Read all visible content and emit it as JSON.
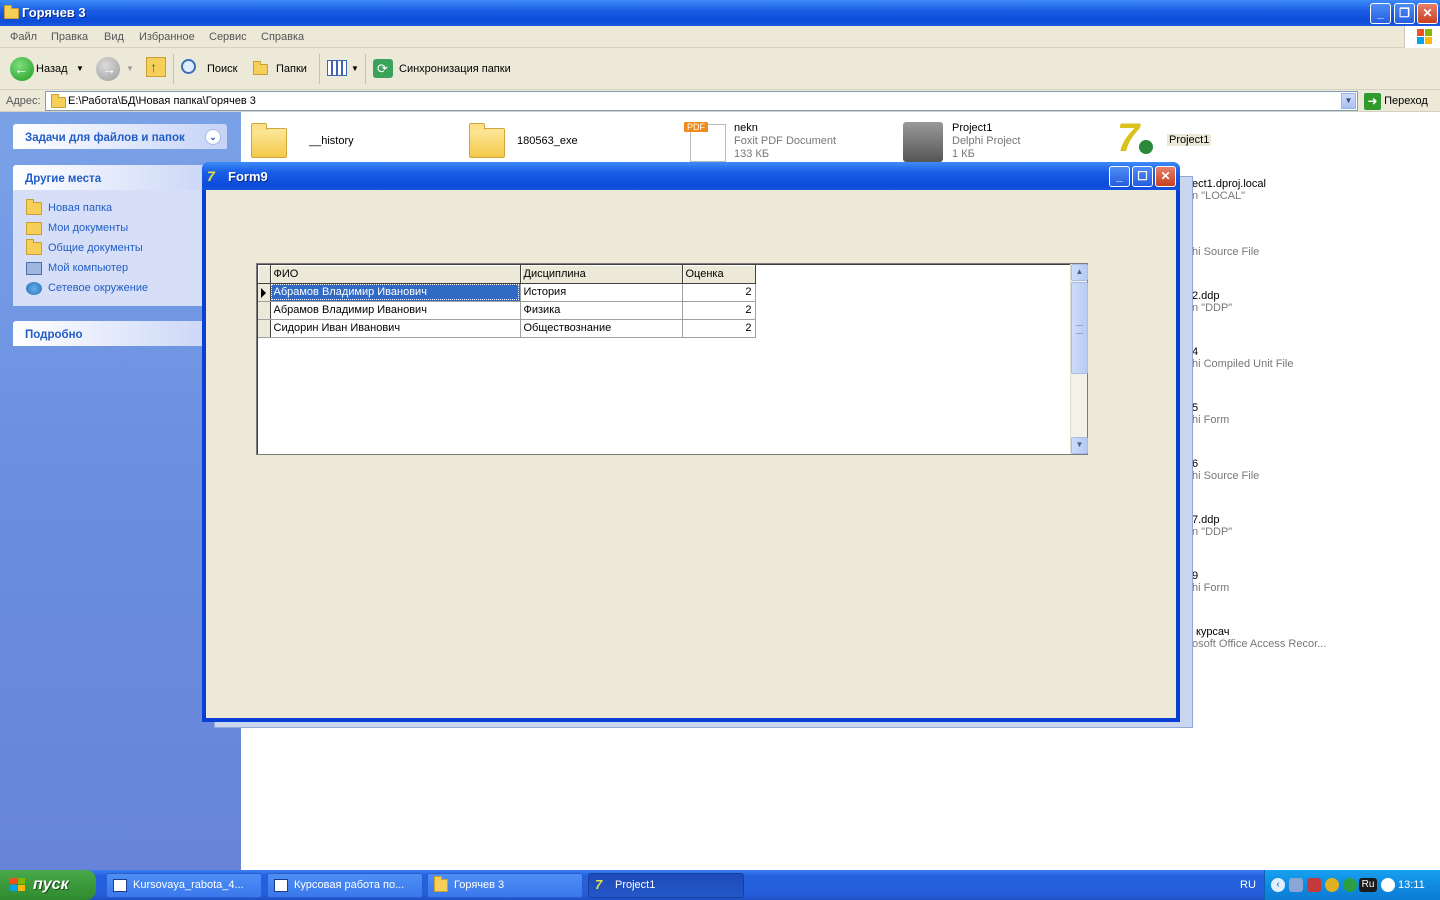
{
  "explorer": {
    "title": "Горячев 3",
    "menu": [
      "Файл",
      "Правка",
      "Вид",
      "Избранное",
      "Сервис",
      "Справка"
    ],
    "toolbar": {
      "back": "Назад",
      "search": "Поиск",
      "folders": "Папки",
      "sync": "Синхронизация папки"
    },
    "address": {
      "label": "Адрес:",
      "value": "E:\\Работа\\БД\\Новая папка\\Горячев 3",
      "go": "Переход"
    }
  },
  "left_panel": {
    "tasks_header": "Задачи для файлов и папок",
    "other_header": "Другие места",
    "other_links": [
      "Новая папка",
      "Мои документы",
      "Общие документы",
      "Мой компьютер",
      "Сетевое окружение"
    ],
    "details_header": "Подробно"
  },
  "files": [
    {
      "name": "__history"
    },
    {
      "name": "180563_exe"
    },
    {
      "name": "nekn",
      "type": "Foxit PDF Document",
      "size": "133 КБ",
      "badge": "PDF"
    },
    {
      "name": "Project1",
      "type": "Delphi Project",
      "size": "1 КБ"
    },
    {
      "name": "Project1"
    }
  ],
  "files_partial": [
    {
      "name": "ect1.dproj.local",
      "type": "n \"LOCAL\""
    },
    {
      "name": "",
      "type": "hi Source File"
    },
    {
      "name": "2.ddp",
      "type": "n \"DDP\""
    },
    {
      "name": "4",
      "type": "hi Compiled Unit File"
    },
    {
      "name": "5",
      "type": "hi Form"
    },
    {
      "name": "6",
      "type": "hi Source File"
    },
    {
      "name": "7.ddp",
      "type": "n \"DDP\""
    },
    {
      "name": "9",
      "type": "hi Form"
    },
    {
      "name": "курсач",
      "type": "osoft Office Access Recor..."
    }
  ],
  "form9": {
    "title": "Form9",
    "grid": {
      "columns": [
        "ФИО",
        "Дисциплина",
        "Оценка"
      ],
      "rows": [
        {
          "fio": "Абрамов Владимир Иванович",
          "discipline": "История",
          "grade": "2"
        },
        {
          "fio": "Абрамов Владимир Иванович",
          "discipline": "Физика",
          "grade": "2"
        },
        {
          "fio": "Сидорин Иван Иванович",
          "discipline": "Обществознание",
          "grade": "2"
        }
      ]
    }
  },
  "taskbar": {
    "start": "пуск",
    "tasks": [
      "Kursovaya_rabota_4...",
      "Курсовая работа по...",
      "Горячев 3",
      "Project1"
    ],
    "lang": "RU",
    "tray_lang": "Ru",
    "clock": "13:11"
  },
  "colors": {
    "xp_blue": "#0b4cd8",
    "selection": "#316ac5",
    "panel_link": "#215dc6"
  }
}
